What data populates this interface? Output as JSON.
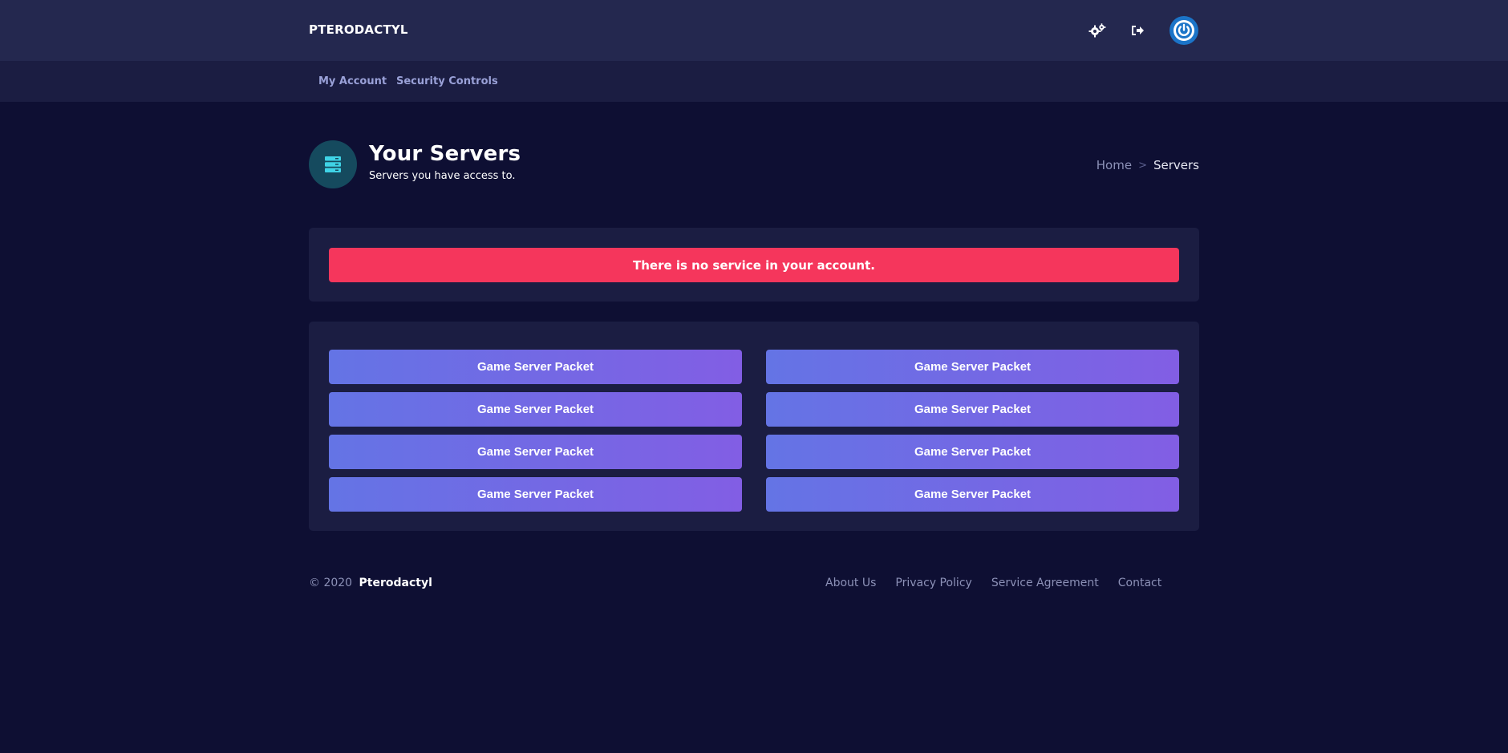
{
  "topbar": {
    "brand": "PTERODACTYL",
    "icons": [
      "gears-icon",
      "sign-out-icon",
      "avatar-power-icon"
    ]
  },
  "subnav": {
    "items": [
      {
        "label": "My Account"
      },
      {
        "label": "Security Controls"
      }
    ]
  },
  "header": {
    "icon": "server-icon",
    "title": "Your Servers",
    "subtitle": "Servers you have access to."
  },
  "breadcrumb": {
    "home": "Home",
    "separator": ">",
    "current": "Servers"
  },
  "alert": {
    "message": "There is no service in your account."
  },
  "packets": [
    {
      "label": "Game Server Packet"
    },
    {
      "label": "Game Server Packet"
    },
    {
      "label": "Game Server Packet"
    },
    {
      "label": "Game Server Packet"
    },
    {
      "label": "Game Server Packet"
    },
    {
      "label": "Game Server Packet"
    },
    {
      "label": "Game Server Packet"
    },
    {
      "label": "Game Server Packet"
    }
  ],
  "footer": {
    "copyright": "© 2020",
    "brand": "Pterodactyl",
    "links": [
      {
        "label": "About Us"
      },
      {
        "label": "Privacy Policy"
      },
      {
        "label": "Service Agreement"
      },
      {
        "label": "Contact"
      }
    ]
  },
  "colors": {
    "background": "#0e0f33",
    "topbar": "#24284f",
    "subnav": "#1b1d42",
    "card": "#1b1d42",
    "alert": "#f5365c",
    "gradient_start": "#6474e5",
    "gradient_end": "#825ee4",
    "header_icon_bg": "#154a5e",
    "header_icon": "#3fd3e6",
    "avatar": "#1b74c8"
  }
}
